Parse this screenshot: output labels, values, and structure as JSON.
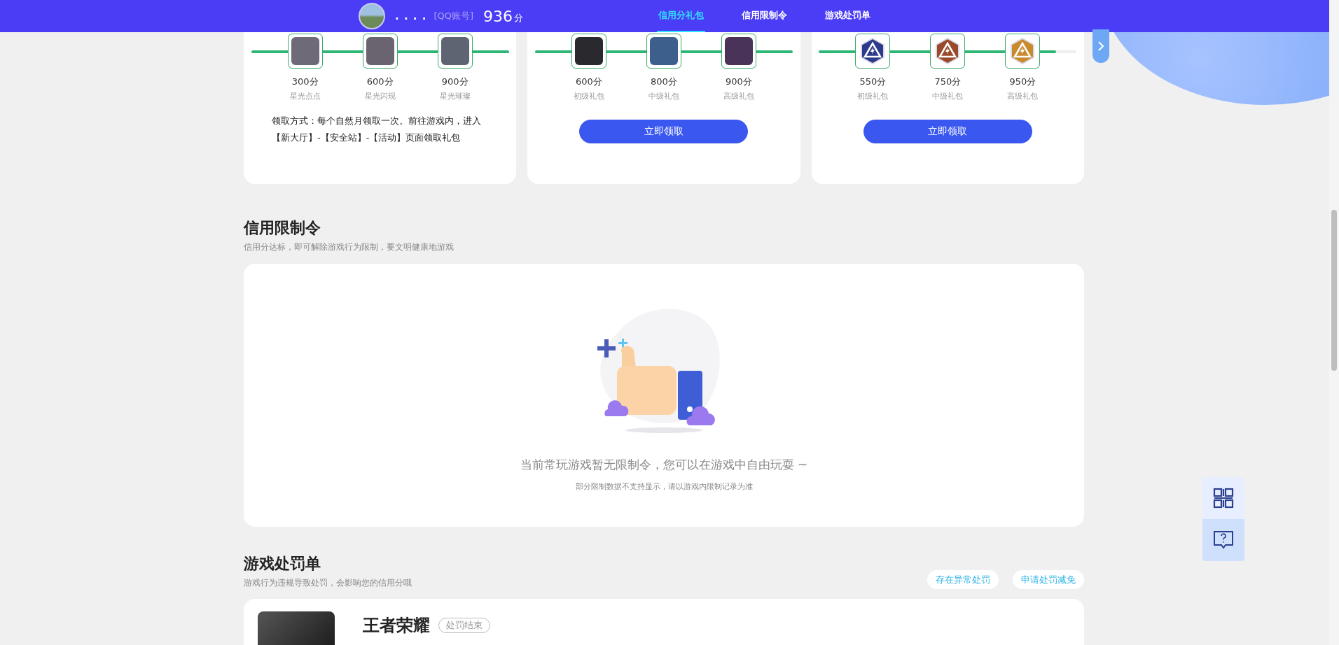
{
  "header": {
    "user_name": ". . . .",
    "account_type": "[QQ账号]",
    "score": "936",
    "score_unit": "分",
    "tabs": [
      {
        "label": "信用分礼包",
        "selected": true
      },
      {
        "label": "信用限制令",
        "selected": false
      },
      {
        "label": "游戏处罚单",
        "selected": false
      }
    ]
  },
  "gift_cards": [
    {
      "level": 1,
      "tiers": [
        {
          "kind": "photo",
          "color": "#6f6a78",
          "score": "300分",
          "name": "星光点点"
        },
        {
          "kind": "photo",
          "color": "#6a6470",
          "score": "600分",
          "name": "星光闪现"
        },
        {
          "kind": "photo",
          "color": "#5e6472",
          "score": "900分",
          "name": "星光璀璨"
        }
      ],
      "note": "领取方式：每个自然月领取一次。前往游戏内，进入【新大厅】-【安全站】-【活动】页面领取礼包"
    },
    {
      "level": 1,
      "tiers": [
        {
          "kind": "photo",
          "color": "#2a2a2e",
          "score": "600分",
          "name": "初级礼包"
        },
        {
          "kind": "photo",
          "color": "#3d5f8c",
          "score": "800分",
          "name": "中级礼包"
        },
        {
          "kind": "photo",
          "color": "#4a3358",
          "score": "900分",
          "name": "高级礼包"
        }
      ],
      "button": "立即领取"
    },
    {
      "level": 0.92,
      "tiers": [
        {
          "kind": "badge",
          "color": "#2b3a8a",
          "score": "550分",
          "name": "初级礼包"
        },
        {
          "kind": "badge",
          "color": "#9a4a2a",
          "score": "750分",
          "name": "中级礼包"
        },
        {
          "kind": "badge",
          "color": "#c98a2c",
          "score": "950分",
          "name": "高级礼包"
        }
      ],
      "button": "立即领取"
    }
  ],
  "restriction": {
    "title": "信用限制令",
    "subtitle": "信用分达标，即可解除游戏行为限制，要文明健康地游戏",
    "empty_text": "当前常玩游戏暂无限制令，您可以在游戏中自由玩耍 ~",
    "empty_note": "部分限制数据不支持显示，请以游戏内限制记录为准"
  },
  "penalty": {
    "title": "游戏处罚单",
    "subtitle": "游戏行为违规导致处罚，会影响您的信用分哦",
    "actions": [
      "存在异常处罚",
      "申请处罚减免"
    ],
    "items": [
      {
        "game": "王者荣耀",
        "status": "处罚结束"
      }
    ]
  }
}
